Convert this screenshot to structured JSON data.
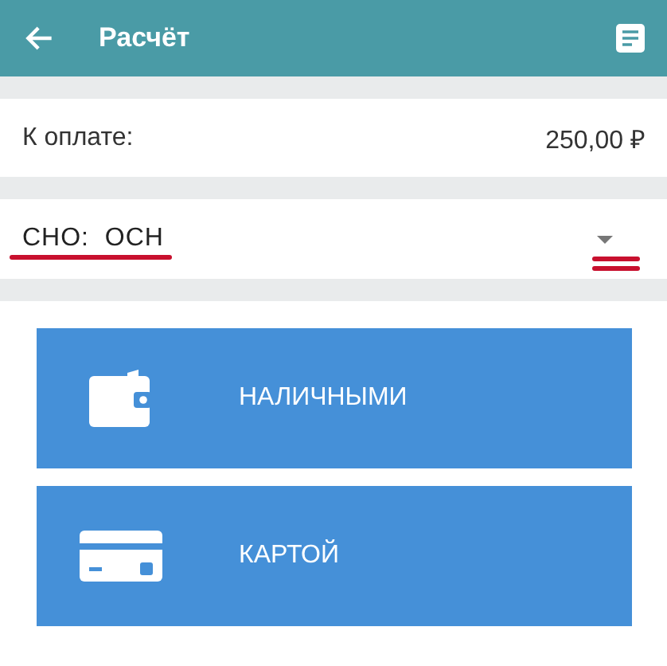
{
  "header": {
    "title": "Расчёт"
  },
  "total": {
    "label": "К оплате:",
    "value": "250,00 ₽"
  },
  "tax_system": {
    "label": "СНО:",
    "value": "ОСН"
  },
  "payment_buttons": [
    {
      "label": "НАЛИЧНЫМИ",
      "kind": "cash"
    },
    {
      "label": "КАРТОЙ",
      "kind": "card"
    }
  ]
}
